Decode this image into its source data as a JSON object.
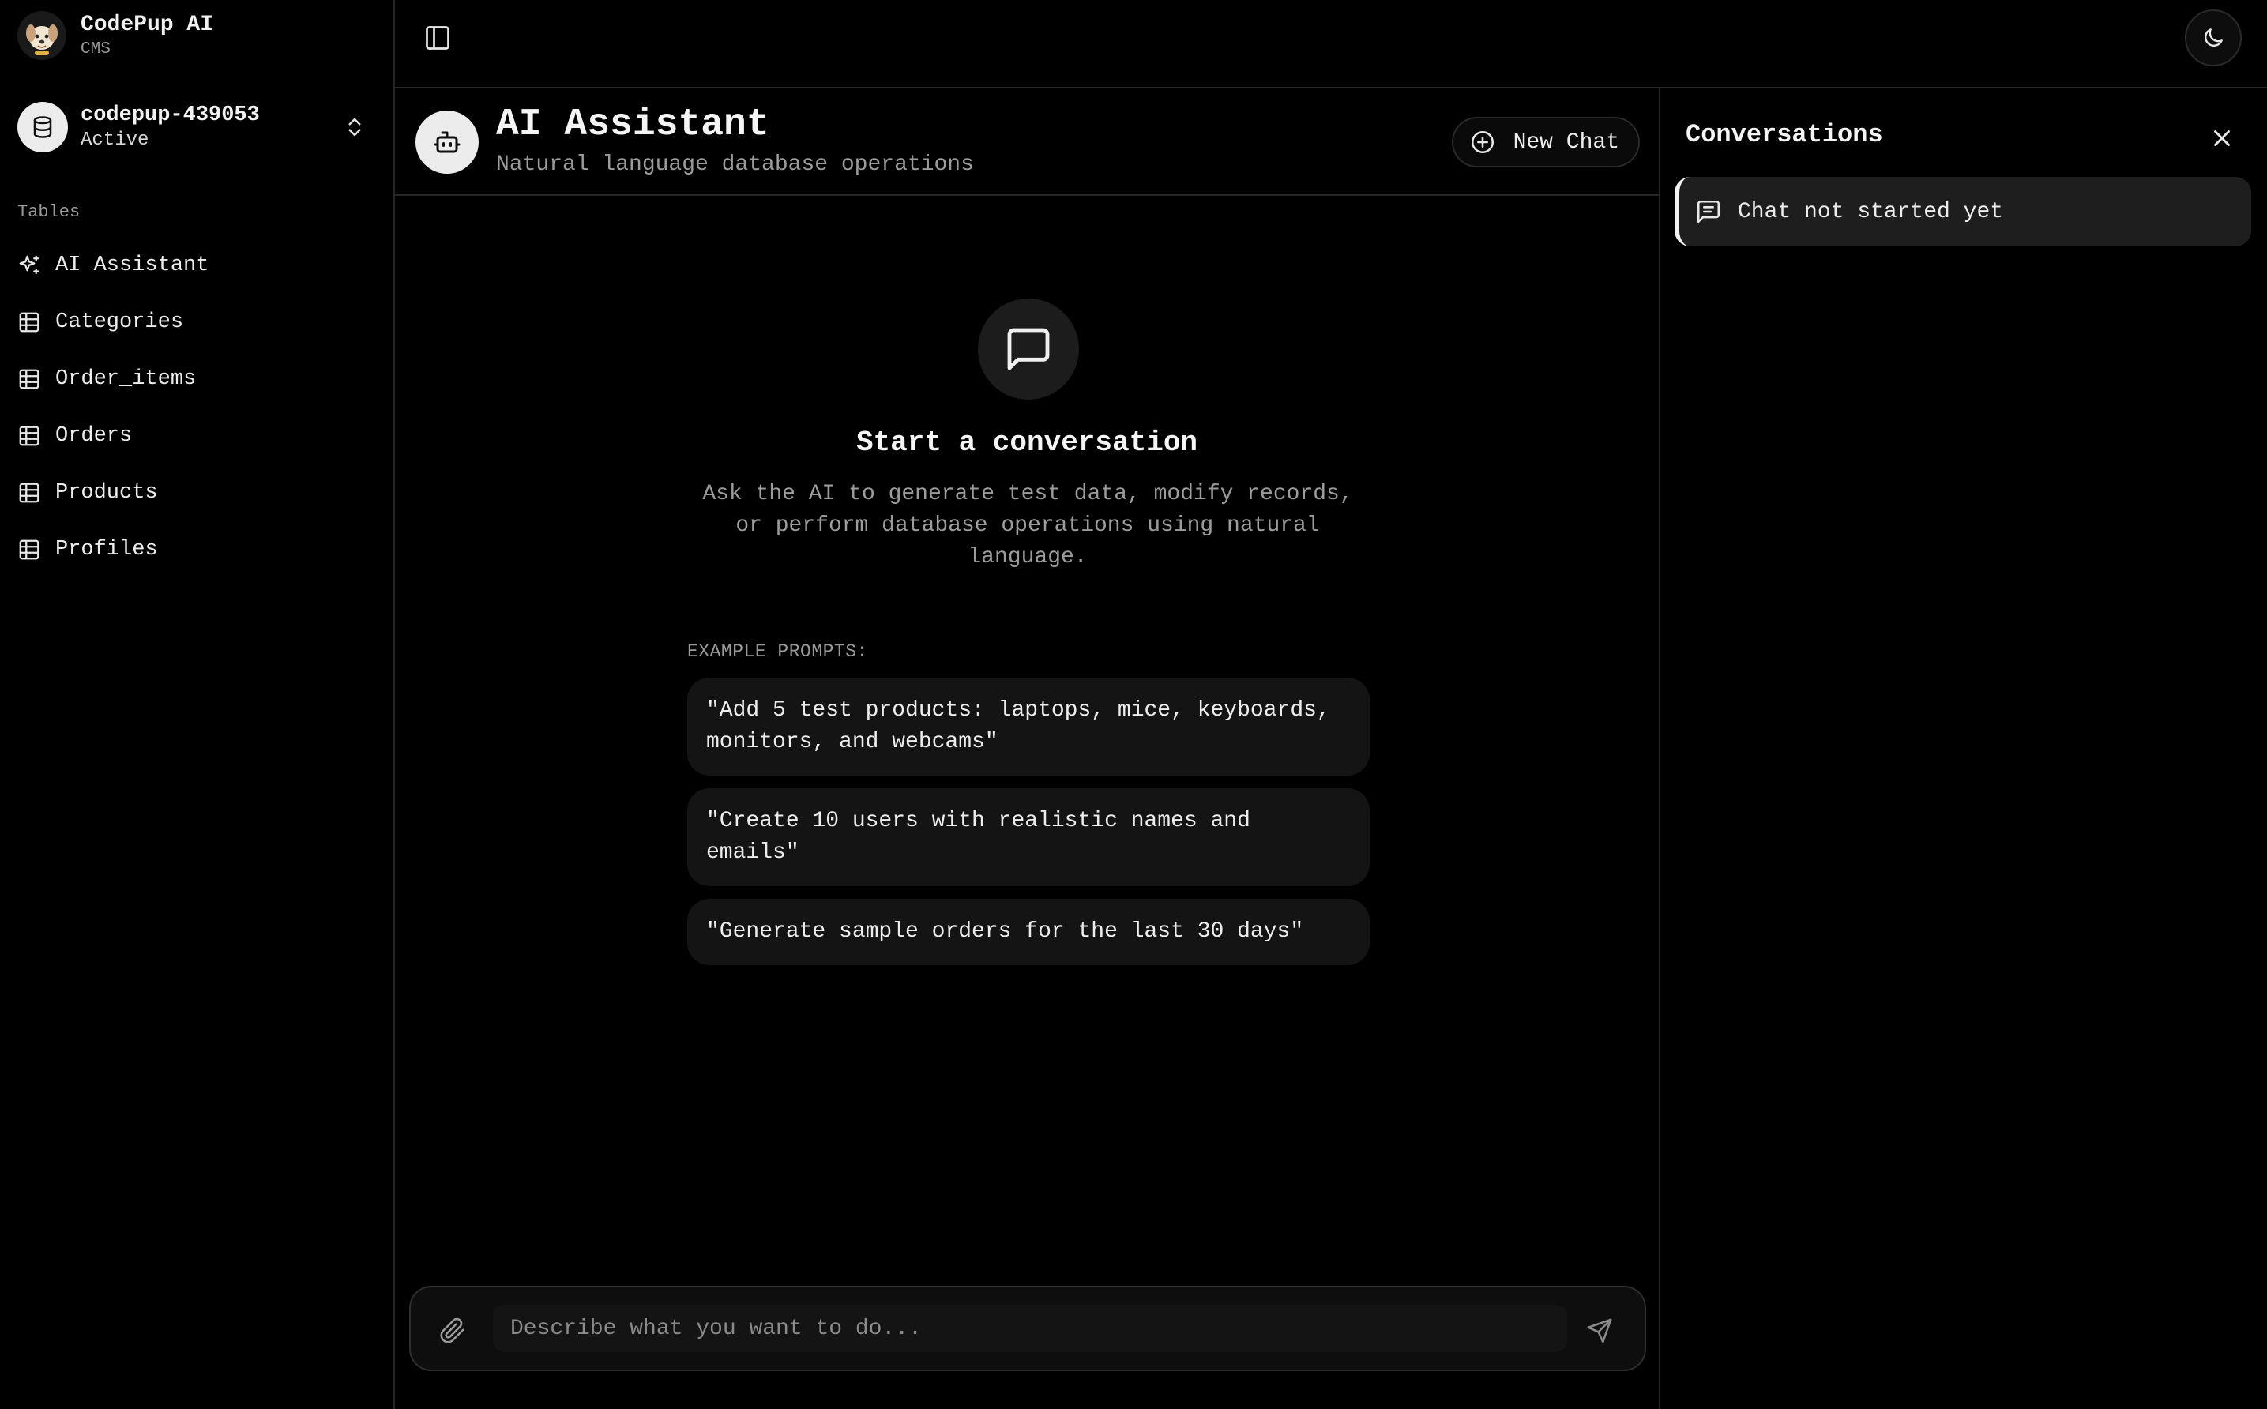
{
  "brand": {
    "title": "CodePup AI",
    "subtitle": "CMS",
    "logo_icon": "puppy-logo"
  },
  "project": {
    "name": "codepup-439053",
    "status": "Active",
    "icon": "database-icon"
  },
  "sidebar": {
    "section_label": "Tables",
    "items": [
      {
        "label": "AI Assistant",
        "icon": "sparkles-icon"
      },
      {
        "label": "Categories",
        "icon": "table-icon"
      },
      {
        "label": "Order_items",
        "icon": "table-icon"
      },
      {
        "label": "Orders",
        "icon": "table-icon"
      },
      {
        "label": "Products",
        "icon": "table-icon"
      },
      {
        "label": "Profiles",
        "icon": "table-icon"
      }
    ]
  },
  "topbar": {
    "toggle_icon": "panel-left-icon",
    "theme_icon": "moon-icon"
  },
  "chat": {
    "title": "AI Assistant",
    "subtitle": "Natural language database operations",
    "new_chat_label": "New Chat",
    "empty_title": "Start a conversation",
    "empty_description": "Ask the AI to generate test data, modify records, or perform database operations using natural language.",
    "examples_label": "EXAMPLE PROMPTS:",
    "examples": [
      "\"Add 5 test products: laptops, mice, keyboards, monitors, and webcams\"",
      "\"Create 10 users with realistic names and emails\"",
      "\"Generate sample orders for the last 30 days\""
    ],
    "input_placeholder": "Describe what you want to do...",
    "input_value": ""
  },
  "conversations": {
    "title": "Conversations",
    "items": [
      {
        "label": "Chat not started yet",
        "icon": "message-square-text-icon"
      }
    ]
  },
  "colors": {
    "background": "#000000",
    "panel": "#141414",
    "border": "#262626",
    "text": "#ededed",
    "muted": "#9c9c9c"
  }
}
